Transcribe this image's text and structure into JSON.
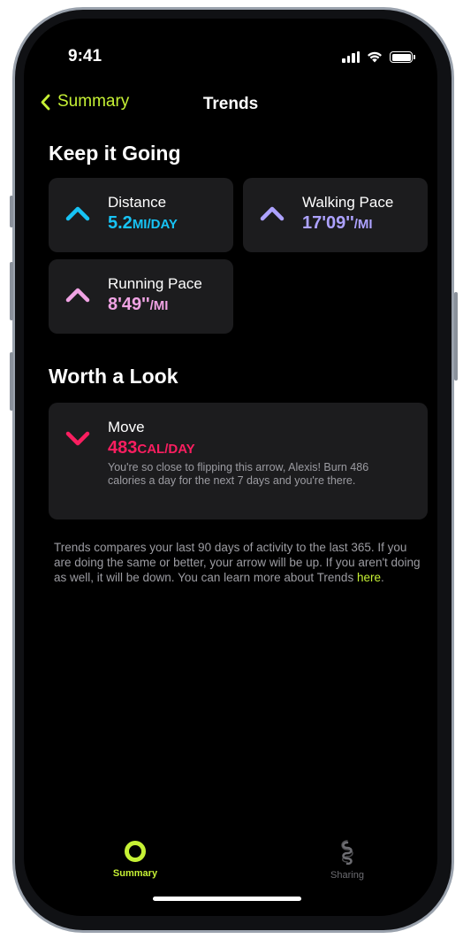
{
  "status_bar": {
    "time": "9:41"
  },
  "nav": {
    "back_label": "Summary",
    "title": "Trends"
  },
  "sections": {
    "keep_going": "Keep it Going",
    "worth_a_look": "Worth a Look"
  },
  "cards": {
    "distance": {
      "label": "Distance",
      "value": "5.2",
      "unit": "MI/DAY",
      "color": "#17c3f5"
    },
    "walking_pace": {
      "label": "Walking Pace",
      "value": "17'09''",
      "unit": "/MI",
      "color": "#ada2ff"
    },
    "running_pace": {
      "label": "Running Pace",
      "value": "8'49''",
      "unit": "/MI",
      "color": "#f0a3e4"
    },
    "move": {
      "label": "Move",
      "value": "483",
      "unit": "CAL/DAY",
      "color": "#fa1e60",
      "description": "You're so close to flipping this arrow, Alexis! Burn 486 calories a day for the next 7 days and you're there."
    }
  },
  "footer": {
    "text": "Trends compares your last 90 days of activity to the last 365. If you are doing the same or better, your arrow will be up. If you aren't doing as well, it will be down. You can learn more about Trends ",
    "link": "here",
    "end": "."
  },
  "tabs": {
    "summary": {
      "label": "Summary",
      "icon": "ring-icon",
      "active": true
    },
    "sharing": {
      "label": "Sharing",
      "icon": "sharing-icon",
      "active": false
    }
  },
  "colors": {
    "accent": "#c6f135",
    "card_bg": "#1c1c1e",
    "secondary_text": "#9c9ca2"
  }
}
